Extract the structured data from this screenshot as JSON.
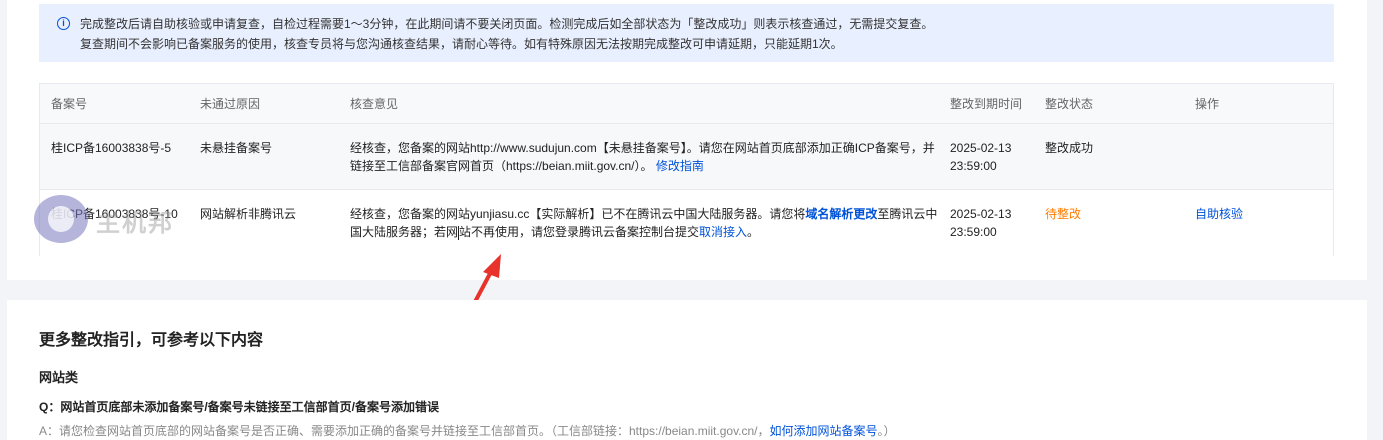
{
  "notice": {
    "line1": "完成整改后请自助核验或申请复查，自检过程需要1～3分钟，在此期间请不要关闭页面。检测完成后如全部状态为「整改成功」则表示核查通过，无需提交复查。",
    "line2": "复查期间不会影响已备案服务的使用，核查专员将与您沟通核查结果，请耐心等待。如有特殊原因无法按期完成整改可申请延期，只能延期1次。"
  },
  "table": {
    "headers": [
      "备案号",
      "未通过原因",
      "核查意见",
      "整改到期时间",
      "整改状态",
      "操作"
    ],
    "rows": [
      {
        "record_no": "桂ICP备16003838号-5",
        "reason": "未悬挂备案号",
        "opinion_text": "经核查，您备案的网站http://www.sudujun.com【未悬挂备案号】。请您在网站首页底部添加正确ICP备案号，并链接至工信部备案官网首页（https://beian.miit.gov.cn/）。",
        "opinion_link": "修改指南",
        "deadline_date": "2025-02-13",
        "deadline_time": "23:59:00",
        "status": "整改成功",
        "action": ""
      },
      {
        "record_no": "桂ICP备16003838号-10",
        "reason": "网站解析非腾讯云",
        "opinion_part1": "经核查，您备案的网站yunjiasu.cc【实际解析】已不在腾讯云中国大陆服务器。请您将",
        "opinion_link1": "域名解析更改",
        "opinion_part2": "至腾讯云中国大陆服务器；若网",
        "opinion_part3": "站不再使用，请您登录腾讯云备案控制台提交",
        "opinion_link2": "取消接入",
        "opinion_part4": "。",
        "deadline_date": "2025-02-13",
        "deadline_time": "23:59:00",
        "status": "待整改",
        "action": "自助核验"
      }
    ]
  },
  "watermark": {
    "text": "主机邦"
  },
  "guide": {
    "title": "更多整改指引，可参考以下内容",
    "section": "网站类",
    "question": "Q：网站首页底部未添加备案号/备案号未链接至工信部首页/备案号添加错误",
    "answer_text": "A：请您检查网站首页底部的网站备案号是否正确、需要添加正确的备案号并链接至工信部首页。（工信部链接：https://beian.miit.gov.cn/，",
    "answer_link": "如何添加网站备案号",
    "answer_end": "。）"
  },
  "colors": {
    "accent": "#0052d9",
    "warning": "#ff7d00",
    "notice_bg": "#e8effe",
    "arrow": "#e8322c"
  }
}
